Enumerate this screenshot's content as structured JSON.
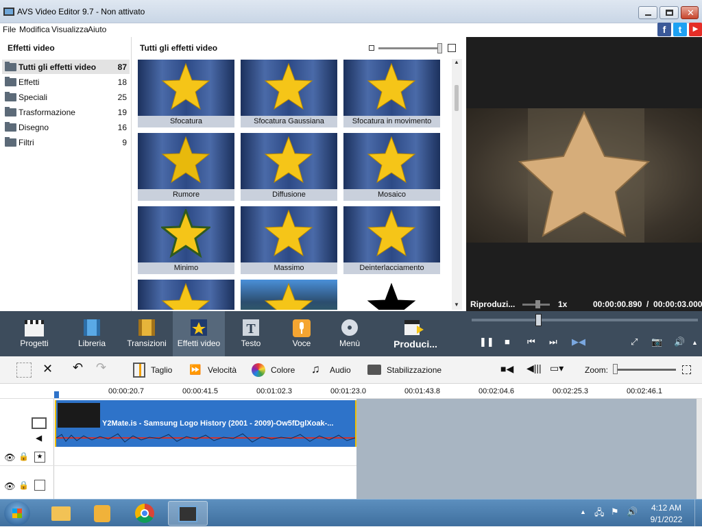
{
  "window": {
    "title": "AVS Video Editor 9.7 - Non attivato"
  },
  "menu": [
    "File",
    "Modifica",
    "Visualizza",
    "Aiuto"
  ],
  "social": [
    "f",
    "t",
    "▶"
  ],
  "left_panel": {
    "header": "Effetti video",
    "categories": [
      {
        "label": "Tutti gli effetti video",
        "count": "87"
      },
      {
        "label": "Effetti",
        "count": "18"
      },
      {
        "label": "Speciali",
        "count": "25"
      },
      {
        "label": "Trasformazione",
        "count": "19"
      },
      {
        "label": "Disegno",
        "count": "16"
      },
      {
        "label": "Filtri",
        "count": "9"
      }
    ]
  },
  "grid": {
    "header": "Tutti gli effetti video",
    "tiles": [
      "Sfocatura",
      "Sfocatura Gaussiana",
      "Sfocatura in movimento",
      "Rumore",
      "Diffusione",
      "Mosaico",
      "Minimo",
      "Massimo",
      "Deinterlacciamento",
      "",
      "",
      ""
    ]
  },
  "preview": {
    "status": "Riproduzi...",
    "speed": "1x",
    "time": "00:00:00.890  /  00:00:03.000"
  },
  "dock": [
    "Progetti",
    "Libreria",
    "Transizioni",
    "Effetti video",
    "Testo",
    "Voce",
    "Menù",
    "Produci..."
  ],
  "toolbar": {
    "taglio": "Taglio",
    "velocita": "Velocità",
    "colore": "Colore",
    "audio": "Audio",
    "stabilizzazione": "Stabilizzazione",
    "zoom": "Zoom:"
  },
  "ruler": [
    "00:00:20.7",
    "00:00:41.5",
    "00:01:02.3",
    "00:01:23.0",
    "00:01:43.8",
    "00:02:04.6",
    "00:02:25.3",
    "00:02:46.1"
  ],
  "clip": {
    "name": "Y2Mate.is - Samsung Logo History (2001 - 2009)-Ow5fDglXoak-..."
  },
  "taskbar": {
    "time": "4:12 AM",
    "date": "9/1/2022"
  }
}
